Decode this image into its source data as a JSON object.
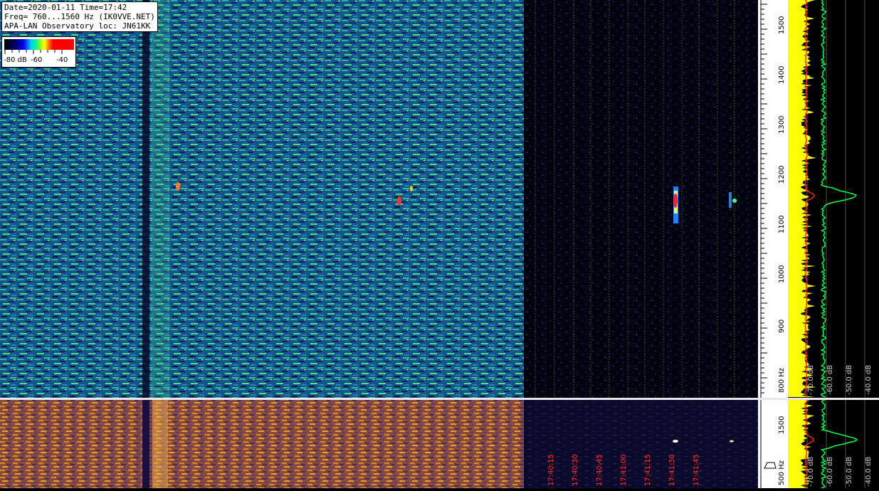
{
  "header": {
    "line1": "Date=2020-01-11 Time=17:42",
    "line2": "Freq= 760...1560 Hz (IK0VVE.NET)",
    "line3": "APA-LAN Observatory loc: JN61KK"
  },
  "legend": {
    "labels": [
      "-80 dB",
      "-60",
      "-40"
    ],
    "colors": [
      "#000000",
      "#0000ff",
      "#00c8ff",
      "#00ff80",
      "#ffff00",
      "#ff0000"
    ]
  },
  "freq_axis": {
    "tick_labels": [
      "1500",
      "1400",
      "1300",
      "1200",
      "1100",
      "1000",
      "900",
      "800 Hz"
    ]
  },
  "bottom_freq_axis": {
    "tick_labels": [
      "1500",
      "500 Hz"
    ]
  },
  "db_axis": {
    "tick_labels": [
      "-70.0 dB",
      "-60.0 dB",
      "-50.0 dB",
      "-40.0 dB"
    ]
  },
  "bottom_db_axis": {
    "tick_labels": [
      "-70.0 dB",
      "-60.0 dB",
      "-50.0 dB",
      "-40.0 dB"
    ]
  },
  "time_axis": {
    "tick_labels": [
      "17:40:15",
      "17:40:30",
      "17:40:45",
      "17:41:00",
      "17:41:15",
      "17:41:30",
      "17:41:45"
    ]
  },
  "colors": {
    "waterfall_dark": "#000000",
    "waterfall_blue": "#0d2a8a",
    "waterfall_teal": "#1c8aa0",
    "waterfall_green": "#40e080",
    "signal_red": "#ff2020",
    "signal_yellow": "#ffff00",
    "spectrum_yellow": "#ffff00",
    "spectrum_green": "#00ff40",
    "spectrum_red": "#ff2020",
    "grid_green": "#2a7a2a",
    "bottom_orange": "#d98a2a",
    "bottom_purple": "#3a2a6a",
    "time_label_red": "#ff3030"
  },
  "icons": [
    "waterfall-spectrogram",
    "color-scale",
    "spectrum-trace"
  ]
}
